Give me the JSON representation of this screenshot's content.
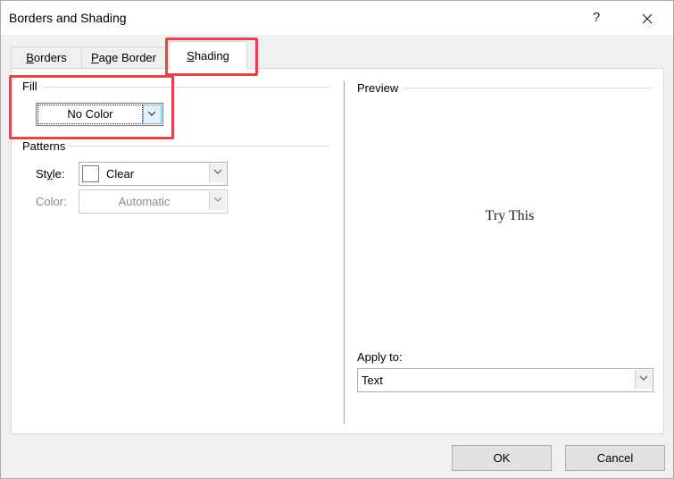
{
  "window": {
    "title": "Borders and Shading",
    "help": "?"
  },
  "tabs": [
    {
      "pre": "",
      "accel": "B",
      "post": "orders",
      "active": false
    },
    {
      "pre": "",
      "accel": "P",
      "post": "age Border",
      "active": false
    },
    {
      "pre": "",
      "accel": "S",
      "post": "hading",
      "active": true
    }
  ],
  "fill": {
    "label": "Fill",
    "value": "No Color"
  },
  "patterns": {
    "label": "Patterns",
    "style_label_pre": "St",
    "style_label_accel": "y",
    "style_label_post": "le:",
    "style_value": "Clear",
    "color_label": "Color:",
    "color_value": "Automatic"
  },
  "preview": {
    "label": "Preview",
    "sample": "Try This"
  },
  "apply_to": {
    "label": "Apply to:",
    "value": "Text"
  },
  "buttons": {
    "ok": "OK",
    "cancel": "Cancel"
  },
  "colors": {
    "highlight": "#e0464d",
    "dropdown_focus": "#7eb4ea"
  }
}
